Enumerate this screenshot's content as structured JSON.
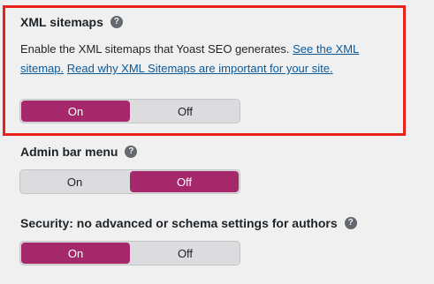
{
  "sections": [
    {
      "heading": "XML sitemaps",
      "help_icon": "help-icon",
      "description_text": "Enable the XML sitemaps that Yoast SEO generates. ",
      "link1": "See the XML sitemap.",
      "link2": "Read why XML Sitemaps are important for your site.",
      "toggle": {
        "on_label": "On",
        "off_label": "Off",
        "selected": "On"
      },
      "highlighted": true
    },
    {
      "heading": "Admin bar menu",
      "help_icon": "help-icon",
      "toggle": {
        "on_label": "On",
        "off_label": "Off",
        "selected": "Off"
      }
    },
    {
      "heading": "Security: no advanced or schema settings for authors",
      "help_icon": "help-icon",
      "toggle": {
        "on_label": "On",
        "off_label": "Off",
        "selected": "On"
      }
    }
  ],
  "colors": {
    "active": "#a4286a",
    "highlight_border": "#e8221b",
    "link": "#0a5a98",
    "background": "#f0f0f1"
  }
}
